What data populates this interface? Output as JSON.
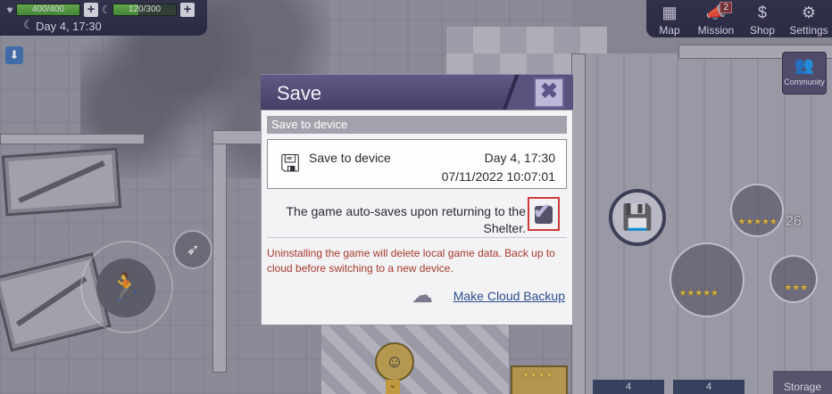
{
  "hud": {
    "health_text": "400/400",
    "health_fill": 1.0,
    "energy_text": "120/300",
    "energy_fill": 0.4,
    "day_time": "Day 4, 17:30",
    "nav": [
      {
        "label": "Map",
        "icon": "map-icon"
      },
      {
        "label": "Mission",
        "icon": "mission-icon",
        "badge": "2"
      },
      {
        "label": "Shop",
        "icon": "shop-icon"
      },
      {
        "label": "Settings",
        "icon": "gear-icon"
      }
    ],
    "community_label": "Community",
    "storage_label": "Storage",
    "slot_counts": [
      "4",
      "4"
    ],
    "item_count": "26"
  },
  "dialog": {
    "title": "Save",
    "section_label": "Save to device",
    "slot": {
      "name": "Save to device",
      "day_time": "Day 4, 17:30",
      "date_time": "07/11/2022 10:07:01"
    },
    "autosave_line1": "The game auto-saves upon returning to the",
    "autosave_line2": "Shelter.",
    "autosave_checked": true,
    "warning": "Uninstalling the game will delete local game data. Back up to cloud before switching to a new device.",
    "cloud_button": "Make Cloud Backup"
  },
  "colors": {
    "header": "#4b4770",
    "warning": "#a63a2a",
    "link": "#2b4d8c",
    "highlight": "#d23a3a"
  }
}
